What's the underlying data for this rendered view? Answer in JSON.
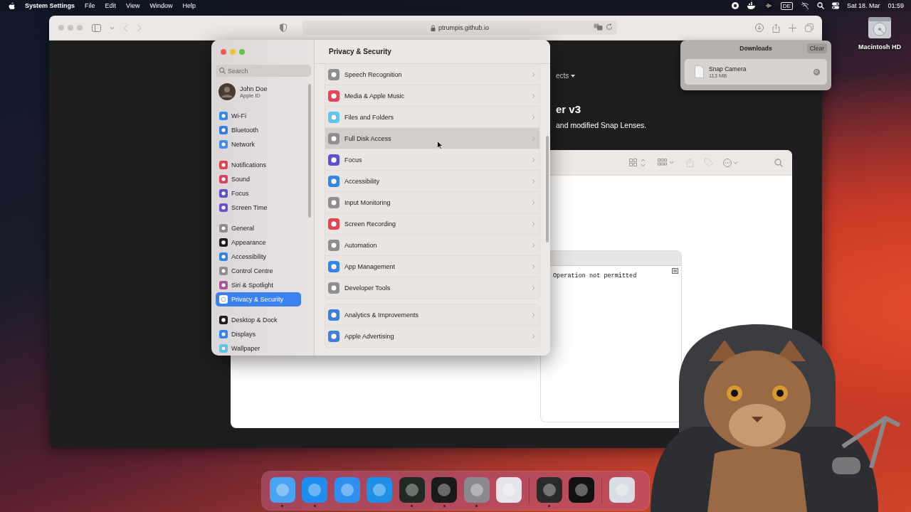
{
  "menu_bar": {
    "app_name": "System Settings",
    "menus": [
      "File",
      "Edit",
      "View",
      "Window",
      "Help"
    ],
    "input_source": "DE",
    "date": "Sat 18. Mar",
    "time": "01:59"
  },
  "desktop_icons": [
    {
      "label": "Macintosh HD"
    }
  ],
  "safari": {
    "url": "ptrumpis.github.io",
    "page": {
      "nav_link": "ects",
      "heading": "er v3",
      "subtitle": "and modified Snap Lenses."
    }
  },
  "terminal": {
    "output": "Operation not permitted"
  },
  "downloads": {
    "title": "Downloads",
    "clear_button": "Clear",
    "items": [
      {
        "name": "Snap Camera",
        "size": "113 MB"
      }
    ]
  },
  "settings": {
    "title": "Privacy & Security",
    "search": {
      "placeholder": "Search"
    },
    "account": {
      "name": "John Doe",
      "subtitle": "Apple ID"
    },
    "sidebar_groups": [
      {
        "items": [
          {
            "label": "Wi-Fi",
            "color": "#2f8cf2",
            "selected": false
          },
          {
            "label": "Bluetooth",
            "color": "#2f7ff0",
            "selected": false
          },
          {
            "label": "Network",
            "color": "#3a8ff2",
            "selected": false
          }
        ]
      },
      {
        "items": [
          {
            "label": "Notifications",
            "color": "#e8434f",
            "selected": false
          },
          {
            "label": "Sound",
            "color": "#e0405a",
            "selected": false
          },
          {
            "label": "Focus",
            "color": "#5b4fd8",
            "selected": false
          },
          {
            "label": "Screen Time",
            "color": "#6a4fd6",
            "selected": false
          }
        ]
      },
      {
        "items": [
          {
            "label": "General",
            "color": "#8e8e93",
            "selected": false
          },
          {
            "label": "Appearance",
            "color": "#1c1c1e",
            "selected": false
          },
          {
            "label": "Accessibility",
            "color": "#2f86f0",
            "selected": false
          },
          {
            "label": "Control Centre",
            "color": "#8e8e93",
            "selected": false
          },
          {
            "label": "Siri & Spotlight",
            "color": "#b2509f",
            "selected": false
          },
          {
            "label": "Privacy & Security",
            "color": "#ffffff",
            "selected": true
          }
        ]
      },
      {
        "items": [
          {
            "label": "Desktop & Dock",
            "color": "#1c1c1e",
            "selected": false
          },
          {
            "label": "Displays",
            "color": "#2f86f0",
            "selected": false
          },
          {
            "label": "Wallpaper",
            "color": "#5ac8ec",
            "selected": false
          }
        ]
      }
    ],
    "list_groups": [
      {
        "rows": [
          {
            "label": "Speech Recognition",
            "color": "#8e8e93",
            "highlighted": false
          },
          {
            "label": "Media & Apple Music",
            "color": "#f0405a",
            "highlighted": false
          },
          {
            "label": "Files and Folders",
            "color": "#5ac8f0",
            "highlighted": false
          },
          {
            "label": "Full Disk Access",
            "color": "#8e8e93",
            "highlighted": true
          },
          {
            "label": "Focus",
            "color": "#5b4fd8",
            "highlighted": false
          },
          {
            "label": "Accessibility",
            "color": "#2f86f0",
            "highlighted": false
          },
          {
            "label": "Input Monitoring",
            "color": "#8e8e93",
            "highlighted": false
          },
          {
            "label": "Screen Recording",
            "color": "#e8434f",
            "highlighted": false
          },
          {
            "label": "Automation",
            "color": "#8e8e93",
            "highlighted": false
          },
          {
            "label": "App Management",
            "color": "#2f86f0",
            "highlighted": false
          },
          {
            "label": "Developer Tools",
            "color": "#8e8e93",
            "highlighted": false
          }
        ]
      },
      {
        "rows": [
          {
            "label": "Analytics & Improvements",
            "color": "#3b7fe0",
            "highlighted": false
          },
          {
            "label": "Apple Advertising",
            "color": "#3b7fe0",
            "highlighted": false
          }
        ]
      }
    ]
  },
  "dock": {
    "apps": [
      {
        "color": "#4aa3f2",
        "running": true
      },
      {
        "color": "#1f8ef1",
        "running": true
      },
      {
        "color": "#2f8ff0",
        "running": false
      },
      {
        "color": "#1d91e6",
        "running": false
      },
      {
        "color": "#1e2a22",
        "running": true
      },
      {
        "color": "#1a1a1a",
        "running": true
      },
      {
        "color": "#8a8a8e",
        "running": true
      },
      {
        "color": "#e8e4ec",
        "running": false
      },
      {
        "color": "#2a2a2a",
        "running": true
      },
      {
        "color": "#111111",
        "running": false
      },
      {
        "color": "#d8dde3",
        "running": false
      }
    ]
  }
}
